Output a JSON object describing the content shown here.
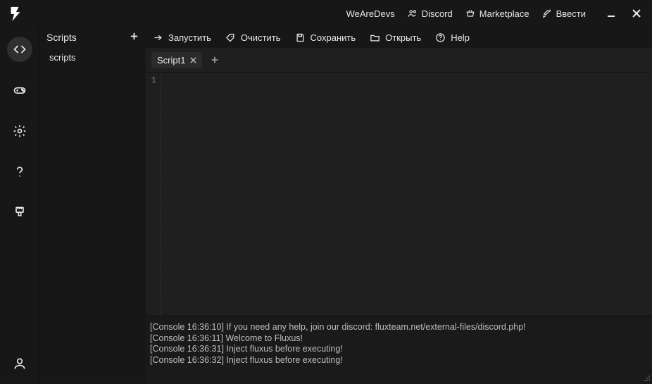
{
  "titlebar": {
    "links": {
      "wearedevs": "WeAreDevs",
      "discord": "Discord",
      "marketplace": "Marketplace",
      "inject": "Ввести"
    }
  },
  "sidebar": {
    "title": "Scripts",
    "items": [
      {
        "label": "scripts"
      }
    ]
  },
  "toolbar": {
    "run": "Запустить",
    "clear": "Очистить",
    "save": "Сохранить",
    "open": "Открыть",
    "help": "Help"
  },
  "tabs": [
    {
      "label": "Script1",
      "active": true
    }
  ],
  "editor": {
    "line_numbers": [
      "1"
    ]
  },
  "console": {
    "lines": [
      "[Console 16:36:10] If you need any help, join our discord: fluxteam.net/external-files/discord.php!",
      "[Console 16:36:11] Welcome to Fluxus!",
      "[Console 16:36:31] Inject fluxus before executing!",
      "[Console 16:36:32] Inject fluxus before executing!"
    ]
  }
}
